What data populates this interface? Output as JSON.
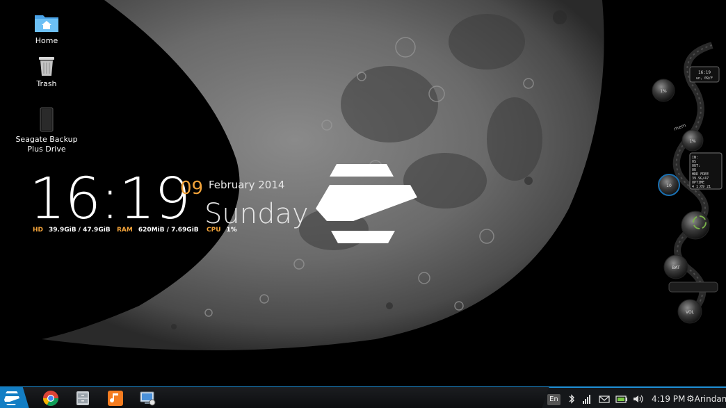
{
  "desktop": {
    "icons": [
      {
        "label": "Home"
      },
      {
        "label": "Trash"
      },
      {
        "label": "Seagate Backup\nPlus Drive"
      }
    ]
  },
  "conky": {
    "time": "16:19",
    "day": "09",
    "month_year": "February 2014",
    "weekday": "Sunday",
    "hd_label": "HD",
    "hd_value": "39.9GiB / 47.9GiB",
    "ram_label": "RAM",
    "ram_value": "620MiB  / 7.69GiB",
    "cpu_label": "CPU",
    "cpu_value": "1%"
  },
  "gadget": {
    "mini_time": "16:19",
    "mini_date": "un, 09/F",
    "cpu_dial": "1%",
    "mem_dial": "1%",
    "net_dial": "10",
    "bat_label": "BAT",
    "vol_label": "VOL",
    "label_mem": "mem",
    "info_lines": [
      "IN:",
      "OS",
      "OUT:",
      "OU",
      "HDD FREE",
      "39.9G/47",
      "UPTIME",
      "4 1:09 21"
    ]
  },
  "taskbar": {
    "apps": [
      {
        "name": "chrome"
      },
      {
        "name": "file-manager"
      },
      {
        "name": "music"
      },
      {
        "name": "remote-desktop"
      }
    ],
    "tray": {
      "keyboard_layout": "En",
      "time": "4:19 PM",
      "user": "Arindam"
    }
  },
  "colors": {
    "accent": "#137ec4",
    "clock_accent": "#f2a33a"
  }
}
